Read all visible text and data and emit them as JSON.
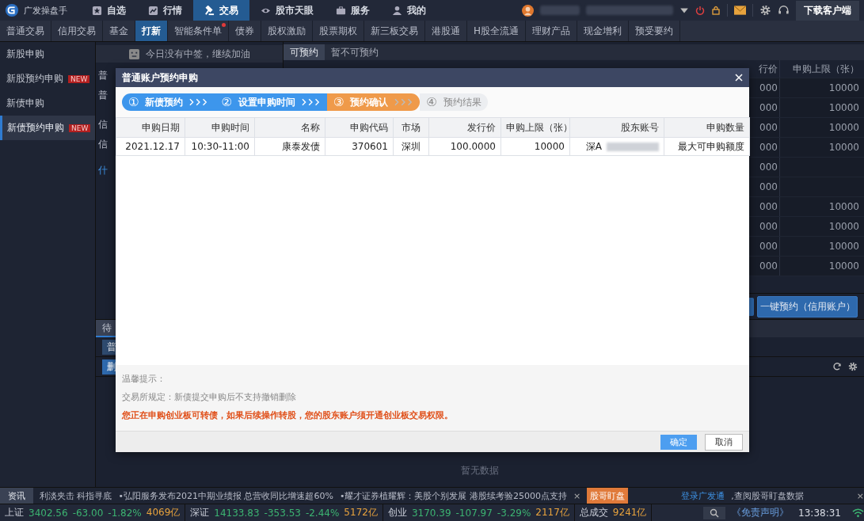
{
  "app": {
    "name": "广发操盘手"
  },
  "nav": [
    {
      "label": "自选",
      "selected": false
    },
    {
      "label": "行情",
      "selected": false
    },
    {
      "label": "交易",
      "selected": true
    },
    {
      "label": "股市天眼",
      "selected": false
    },
    {
      "label": "服务",
      "selected": false
    },
    {
      "label": "我的",
      "selected": false
    }
  ],
  "download_button": "下载客户端",
  "subnav": [
    {
      "label": "普通交易",
      "selected": false,
      "dot": false
    },
    {
      "label": "信用交易",
      "selected": false,
      "dot": false
    },
    {
      "label": "基金",
      "selected": false,
      "dot": false
    },
    {
      "label": "打新",
      "selected": true,
      "dot": false
    },
    {
      "label": "智能条件单",
      "selected": false,
      "dot": true
    },
    {
      "label": "债券",
      "selected": false,
      "dot": false
    },
    {
      "label": "股权激励",
      "selected": false,
      "dot": false
    },
    {
      "label": "股票期权",
      "selected": false,
      "dot": false
    },
    {
      "label": "新三板交易",
      "selected": false,
      "dot": false
    },
    {
      "label": "港股通",
      "selected": false,
      "dot": false
    },
    {
      "label": "H股全流通",
      "selected": false,
      "dot": false
    },
    {
      "label": "理财产品",
      "selected": false,
      "dot": false
    },
    {
      "label": "现金增利",
      "selected": false,
      "dot": false
    },
    {
      "label": "预受要约",
      "selected": false,
      "dot": false
    }
  ],
  "sidebar": [
    {
      "label": "新股申购",
      "selected": false
    },
    {
      "label": "新股预约申购",
      "badge": "NEW",
      "selected": false
    },
    {
      "label": "新债申购",
      "selected": false
    },
    {
      "label": "新债预约申购",
      "badge": "NEW",
      "selected": true
    }
  ],
  "banner": "今日没有中签，继续加油",
  "left_panel": {
    "lines": [
      "普",
      "普",
      "信",
      "信"
    ],
    "link": "什"
  },
  "list_tabs": [
    {
      "label": "可预约",
      "selected": true
    },
    {
      "label": "暂不可预约",
      "selected": false
    }
  ],
  "list_table": {
    "columns": [
      "行价",
      "申购上限（张）"
    ],
    "rows": [
      {
        "price": "000",
        "limit": "10000"
      },
      {
        "price": "000",
        "limit": "10000"
      },
      {
        "price": "000",
        "limit": "10000"
      },
      {
        "price": "000",
        "limit": "10000"
      },
      {
        "price": "000"
      },
      {
        "price": "000"
      },
      {
        "price": "000",
        "limit": "10000"
      },
      {
        "price": "000",
        "limit": "10000"
      },
      {
        "price": "000",
        "limit": "10000"
      },
      {
        "price": "000",
        "limit": "10000"
      }
    ]
  },
  "primary_action": "一键预约（信用账户）",
  "bottom_panel": {
    "tab": "待",
    "sub_tab": "普",
    "action": "删",
    "empty": "暂无数据"
  },
  "dialog": {
    "title": "普通账户预约申购",
    "steps": [
      {
        "number": "①",
        "label": "新债预约",
        "done": true,
        "selected": false
      },
      {
        "number": "②",
        "label": "设置申购时间",
        "done": true,
        "selected": false
      },
      {
        "number": "③",
        "label": "预约确认",
        "done": false,
        "selected": true
      },
      {
        "number": "④",
        "label": "预约结果",
        "done": false,
        "selected": false
      }
    ],
    "columns": [
      "申购日期",
      "申购时间",
      "名称",
      "申购代码",
      "市场",
      "发行价",
      "申购上限（张）",
      "股东账号",
      "申购数量"
    ],
    "rows": [
      [
        "2021.12.17",
        "10:30-11:00",
        "康泰发债",
        "370601",
        "深圳",
        "100.0000",
        "10000",
        "深A",
        "最大可申购额度"
      ]
    ],
    "notice_title": "温馨提示：",
    "notice": "交易所规定：新债提交申购后不支持撤销删除",
    "warning": "您正在申购创业板可转债，如果后续操作转股，您的股东账户须开通创业板交易权限。",
    "ok": "确定",
    "cancel": "取消"
  },
  "ticker": {
    "tab": "资讯",
    "items": [
      "利淡夹击 科指寻底",
      "•弘阳服务发布2021中期业绩报 总营收同比增速超60%",
      "•耀才证券植耀辉：美股个别发展 港股续考验25000点支持"
    ],
    "close": "×",
    "badge": "股哥盯盘",
    "link": "登录广发通",
    "link_suffix": ",查阅股哥盯盘数据",
    "close_right": "×"
  },
  "status_bar": {
    "indices": [
      {
        "name": "上证",
        "value": "3402.56",
        "change": "-63.00",
        "percent": "-1.82%",
        "amount": "4069亿"
      },
      {
        "name": "深证",
        "value": "14133.83",
        "change": "-353.53",
        "percent": "-2.44%",
        "amount": "5172亿"
      },
      {
        "name": "创业",
        "value": "3170.39",
        "change": "-107.97",
        "percent": "-3.29%",
        "amount": "2117亿"
      }
    ],
    "total_label": "总成交",
    "total": "9241亿",
    "disclaimer": "《免责声明》",
    "time": "13:38:31"
  }
}
